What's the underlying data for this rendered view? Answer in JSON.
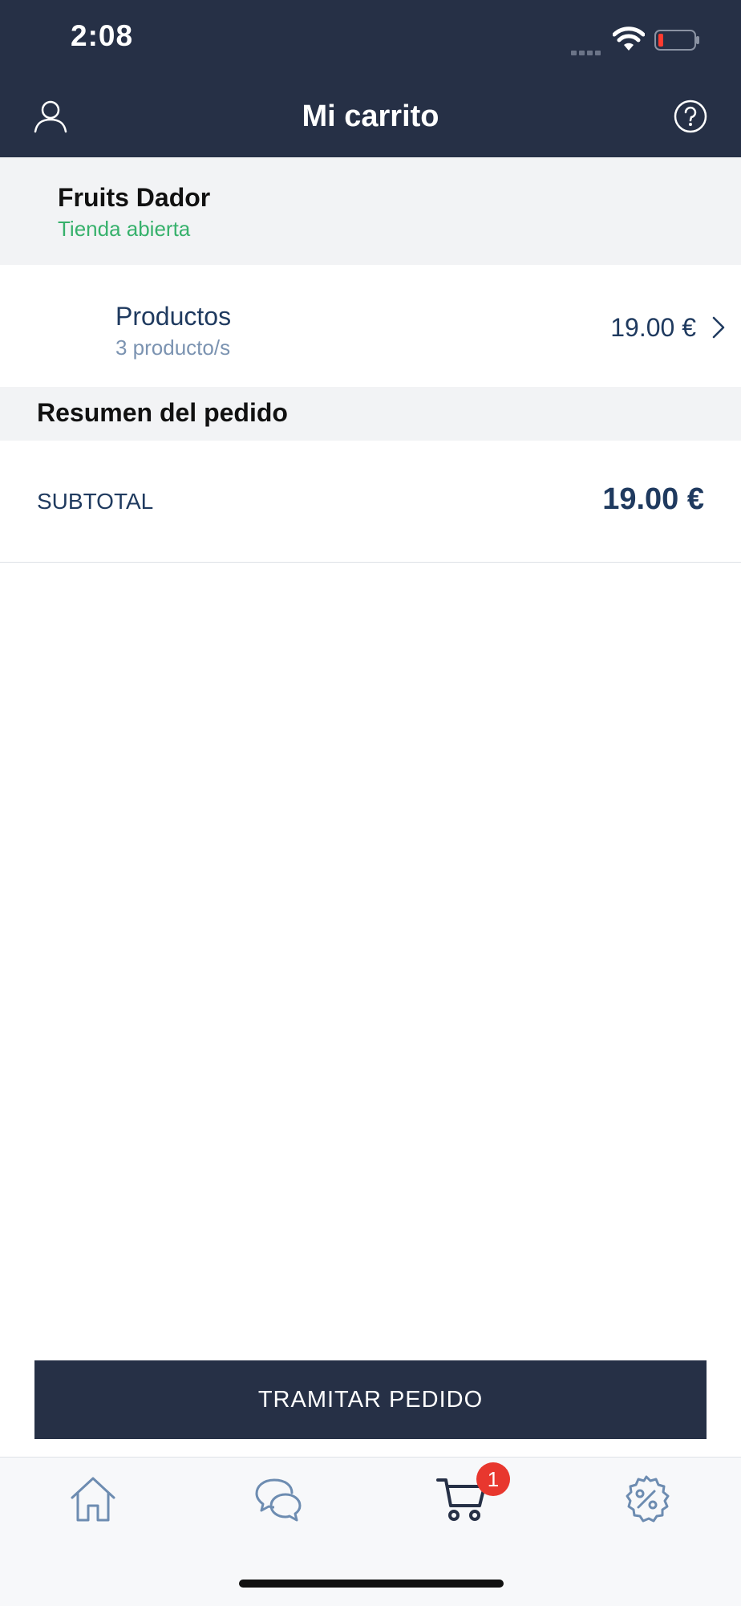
{
  "status_bar": {
    "time": "2:08"
  },
  "header": {
    "title": "Mi carrito",
    "profile_icon": "user-icon",
    "help_icon": "help-icon"
  },
  "store": {
    "name": "Fruits Dador",
    "status": "Tienda abierta",
    "status_color": "#37b16c"
  },
  "products": {
    "label": "Productos",
    "count": "3 producto/s",
    "price": "19.00 €"
  },
  "summary": {
    "title": "Resumen del pedido",
    "subtotal_label": "SUBTOTAL",
    "subtotal_value": "19.00 €"
  },
  "checkout": {
    "label": "TRAMITAR PEDIDO"
  },
  "tabbar": {
    "items": [
      {
        "icon": "home-icon"
      },
      {
        "icon": "chat-icon"
      },
      {
        "icon": "cart-icon",
        "badge": "1"
      },
      {
        "icon": "discount-icon"
      }
    ]
  },
  "colors": {
    "primary": "#263046",
    "accent_text": "#1f3a5f",
    "badge": "#e8372e"
  }
}
